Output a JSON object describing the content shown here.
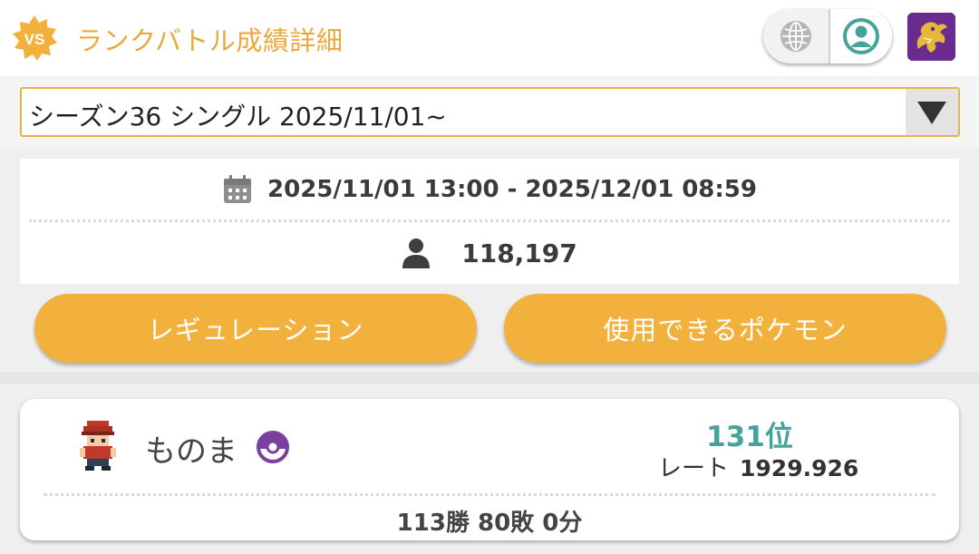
{
  "header": {
    "badge_text": "VS",
    "title": "ランクバトル成績詳細",
    "icons": {
      "language": "globe-icon",
      "account": "account-circle-icon",
      "avatar": "dragon-avatar-icon"
    },
    "colors": {
      "title": "#eaa93a",
      "badge": "#f2b13c",
      "account_icon": "#46a39b",
      "avatar_bg": "#6a2a8e"
    }
  },
  "season_select": {
    "selected": "シーズン36 シングル 2025/11/01~",
    "icon": "dropdown-triangle-icon"
  },
  "info": {
    "period": "2025/11/01 13:00 - 2025/12/01 08:59",
    "period_icon": "calendar-icon",
    "players": "118,197",
    "players_icon": "person-icon"
  },
  "buttons": {
    "regulation": "レギュレーション",
    "usable_pokemon": "使用できるポケモン",
    "color": "#f2b13c"
  },
  "player": {
    "name": "ものま",
    "sprite_icon": "trainer-sprite-icon",
    "ball_icon": "poke-ball-icon",
    "rank": "131位",
    "rate_label": "レート",
    "rate_value": "1929.926",
    "record": "113勝 80敗 0分",
    "rank_color": "#46a39b"
  }
}
